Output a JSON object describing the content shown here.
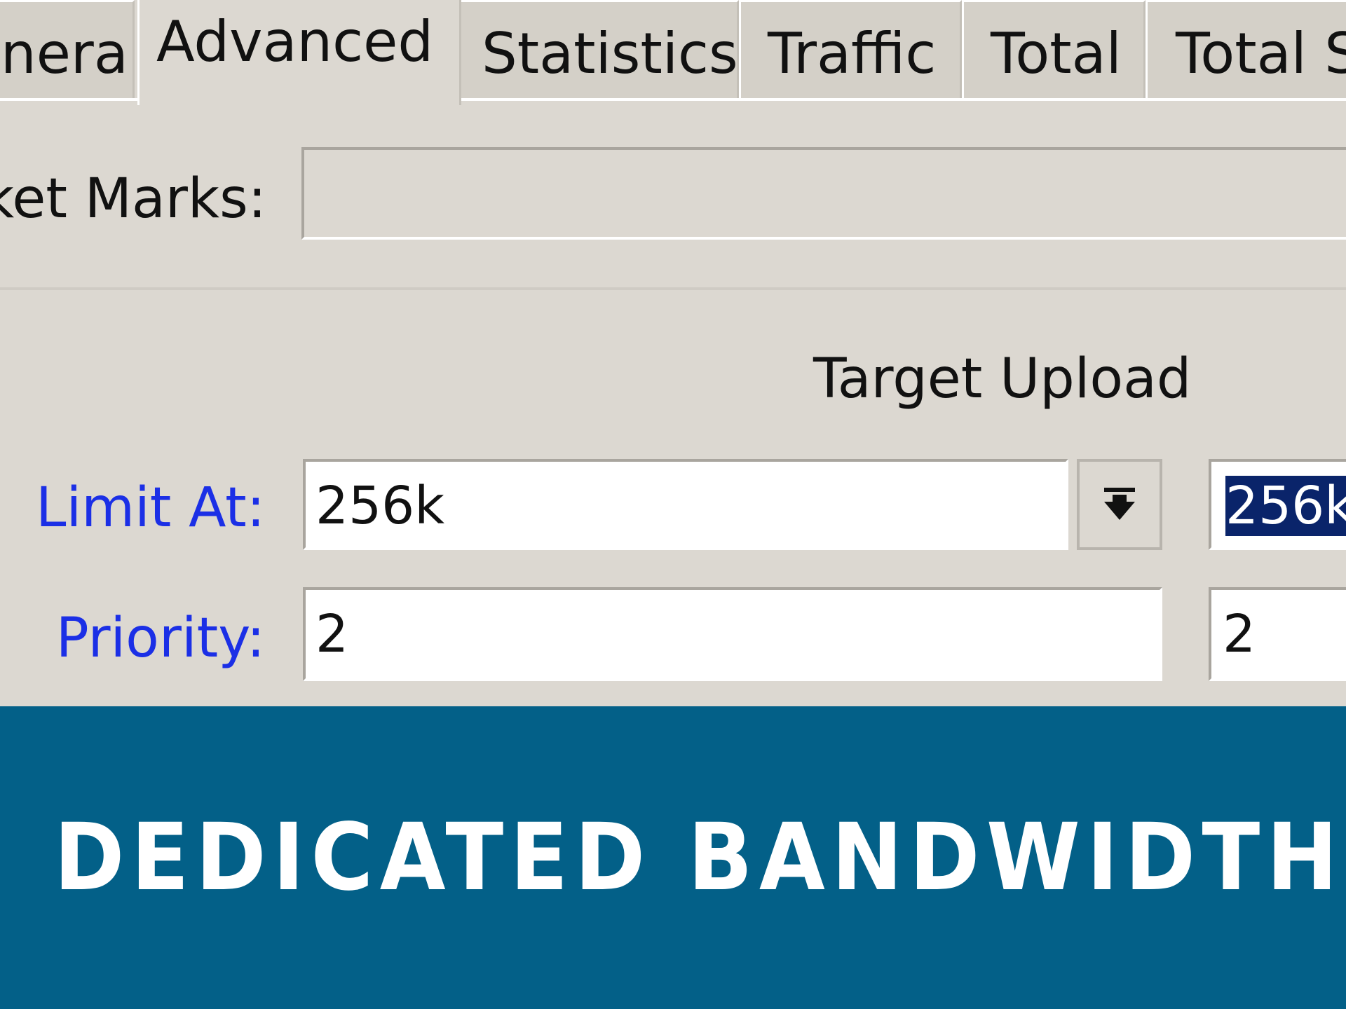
{
  "tabs": [
    {
      "label": "neral",
      "active": false
    },
    {
      "label": "Advanced",
      "active": true
    },
    {
      "label": "Statistics",
      "active": false
    },
    {
      "label": "Traffic",
      "active": false
    },
    {
      "label": "Total",
      "active": false
    },
    {
      "label": "Total S",
      "active": false
    }
  ],
  "packet_marks": {
    "label": "cket Marks:",
    "value": ""
  },
  "column_header": "Target Upload",
  "limit_at": {
    "label": "Limit At:",
    "upload_value": "256k",
    "download_value": "256k",
    "stepper_icon": "arrow-down-to-line-icon"
  },
  "priority": {
    "label": "Priority:",
    "upload_value": "2",
    "download_value": "2"
  },
  "banner": {
    "title": "DEDICATED BANDWIDTH",
    "background_color": "#036088",
    "text_color": "#ffffff"
  },
  "colors": {
    "panel": "#dcd8d1",
    "label_blue": "#1b2fe6",
    "selection": "#0a246a"
  }
}
